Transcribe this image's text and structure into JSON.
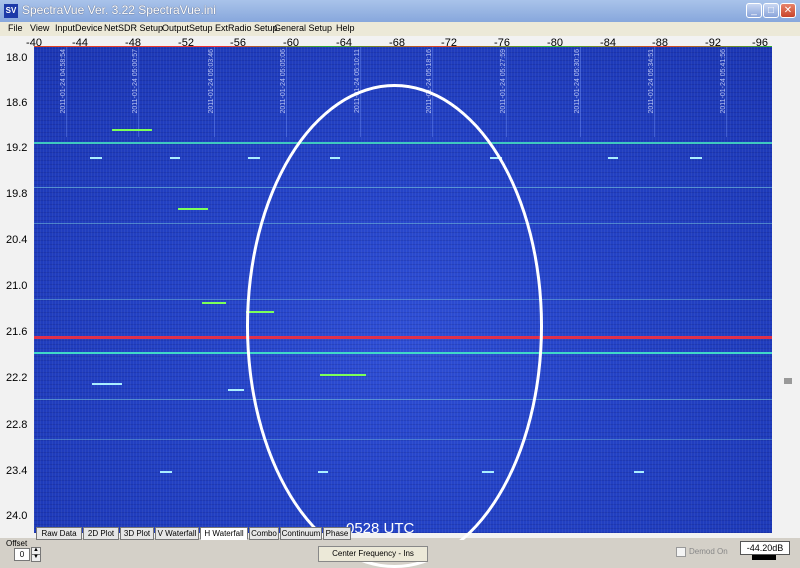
{
  "window": {
    "title": "SpectraVue Ver. 3.22  SpectraVue.ini",
    "icon": "SV"
  },
  "menu": [
    "File",
    "View",
    "InputDevice",
    "NetSDR Setup",
    "OutputSetup",
    "ExtRadio Setup",
    "General Setup",
    "Help"
  ],
  "x_axis": {
    "ticks": [
      "-40",
      "-44",
      "-48",
      "-52",
      "-56",
      "-60",
      "-64",
      "-68",
      "-72",
      "-76",
      "-80",
      "-84",
      "-88",
      "-92",
      "-96"
    ]
  },
  "y_axis": {
    "ticks": [
      "18.0",
      "18.6",
      "19.2",
      "19.8",
      "20.4",
      "21.0",
      "21.6",
      "22.2",
      "22.8",
      "23.4",
      "24.0"
    ]
  },
  "timestamps": [
    "2011-01-24 04:58:54",
    "2011-01-24 05:00:57",
    "2011-01-24 05:03:46",
    "2011-01-24 05:05:06",
    "2011-01-24 05:10:11",
    "2011-01-24 05:18:16",
    "2011-01-24 05:27:59",
    "2011-01-24 05:30:16",
    "2011-01-24 05:34:51",
    "2011-01-24 05:41:56"
  ],
  "annotation": {
    "label": "0528 UTC",
    "color": "#ffffff"
  },
  "tabs": [
    {
      "label": "Raw Data",
      "active": false
    },
    {
      "label": "2D Plot",
      "active": false
    },
    {
      "label": "3D Plot",
      "active": false
    },
    {
      "label": "V Waterfall",
      "active": false
    },
    {
      "label": "H Waterfall",
      "active": true
    },
    {
      "label": "Combo",
      "active": false
    },
    {
      "label": "Continuum",
      "active": false
    },
    {
      "label": "Phase",
      "active": false
    }
  ],
  "bottom": {
    "offset_label": "Offset",
    "offset_value": "0",
    "center_button": "Center Frequency - Ins",
    "demod_label": "Demod On",
    "db_readout": "-44.20dB"
  },
  "colors": {
    "waterfall_bg": "#2443c7",
    "red_line": "#e0304a",
    "cyan_line": "#40d8c8",
    "green_blip": "#7cff5a"
  }
}
